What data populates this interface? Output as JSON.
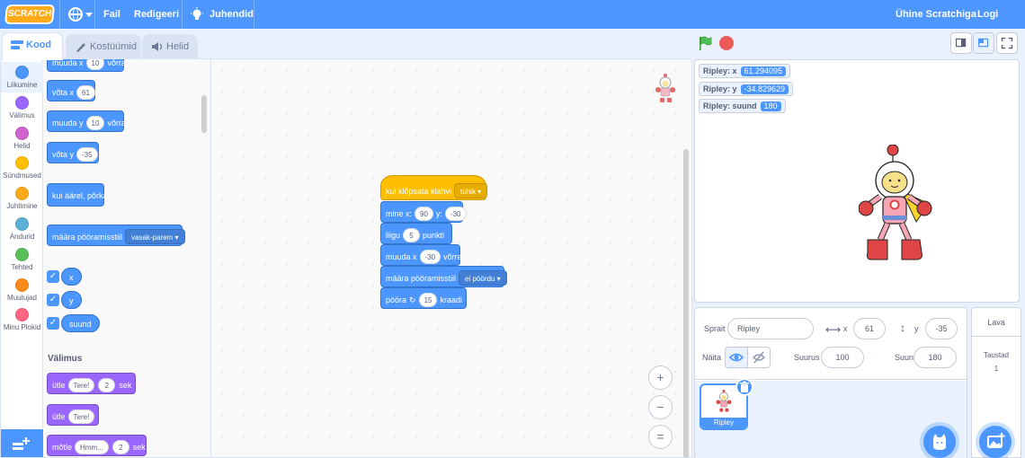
{
  "menubar": {
    "logo": "SCRATCH",
    "file": "Fail",
    "edit": "Redigeeri",
    "tutorials": "Juhendid",
    "join": "Ühine Scratchiga",
    "signin": "Logi sisse",
    "colors": {
      "bar": "#4d97ff"
    }
  },
  "tabs": {
    "code": "Kood",
    "costumes": "Kostüümid",
    "sounds": "Helid"
  },
  "categories": [
    {
      "label": "Liikumine",
      "color": "#4c97ff"
    },
    {
      "label": "Välimus",
      "color": "#9966ff"
    },
    {
      "label": "Helid",
      "color": "#cf63cf"
    },
    {
      "label": "Sündmused",
      "color": "#ffbf00"
    },
    {
      "label": "Juhtimine",
      "color": "#ffab19"
    },
    {
      "label": "Andurid",
      "color": "#5cb1d6"
    },
    {
      "label": "Tehted",
      "color": "#59c059"
    },
    {
      "label": "Muutujad",
      "color": "#ff8c1a"
    },
    {
      "label": "Minu Plokid",
      "color": "#ff6680"
    }
  ],
  "palette": {
    "b0": {
      "pre": "muuda x",
      "val": "10",
      "post": "võrra"
    },
    "b1": {
      "pre": "võta x",
      "val": "61"
    },
    "b2": {
      "pre": "muuda y",
      "val": "10",
      "post": "võrra"
    },
    "b3": {
      "pre": "võta y",
      "val": "-35"
    },
    "b4": {
      "pre": "kui äärel, põrka"
    },
    "b5": {
      "pre": "määra pööramisstiil",
      "dd": "vasak-parem"
    },
    "r_x": "x",
    "r_y": "y",
    "r_dir": "suund",
    "looks_title": "Välimus",
    "l1": {
      "pre": "ütle",
      "val": "Tere!",
      "val2": "2",
      "post": "sek"
    },
    "l2": {
      "pre": "ütle",
      "val": "Tere!"
    },
    "l3": {
      "pre": "mõtle",
      "val": "Hmm...",
      "val2": "2",
      "post": "sek"
    }
  },
  "script": {
    "hat": {
      "pre": "kui klõpsata klahvi",
      "dd": "tühik"
    },
    "s1": {
      "pre": "mine x:",
      "val": "90",
      "mid": "y:",
      "val2": "-30"
    },
    "s2": {
      "pre": "liigu",
      "val": "5",
      "post": "punkti"
    },
    "s3": {
      "pre": "muuda x",
      "val": "-30",
      "post": "võrra"
    },
    "s4": {
      "pre": "määra pööramisstiil",
      "dd": "ei pöördu"
    },
    "s5": {
      "pre": "pööra",
      "val": "15",
      "post": "kraadi"
    }
  },
  "zoom": {
    "in": "+",
    "out": "−",
    "reset": "="
  },
  "stage": {
    "monitors": [
      {
        "label": "Ripley: x",
        "value": "61.294095"
      },
      {
        "label": "Ripley: y",
        "value": "-34.829629"
      },
      {
        "label": "Ripley: suund",
        "value": "180"
      }
    ]
  },
  "sprite_info": {
    "sprite_label": "Sprait",
    "sprite_name": "Ripley",
    "x_label": "x",
    "x_value": "61",
    "y_label": "y",
    "y_value": "-35",
    "show_label": "Näita",
    "size_label": "Suurus",
    "size_value": "100",
    "dir_label": "Suund",
    "dir_value": "180"
  },
  "sprites": [
    {
      "name": "Ripley"
    }
  ],
  "stage_pane": {
    "title": "Lava",
    "backdrops_label": "Taustad",
    "backdrops_count": "1"
  }
}
